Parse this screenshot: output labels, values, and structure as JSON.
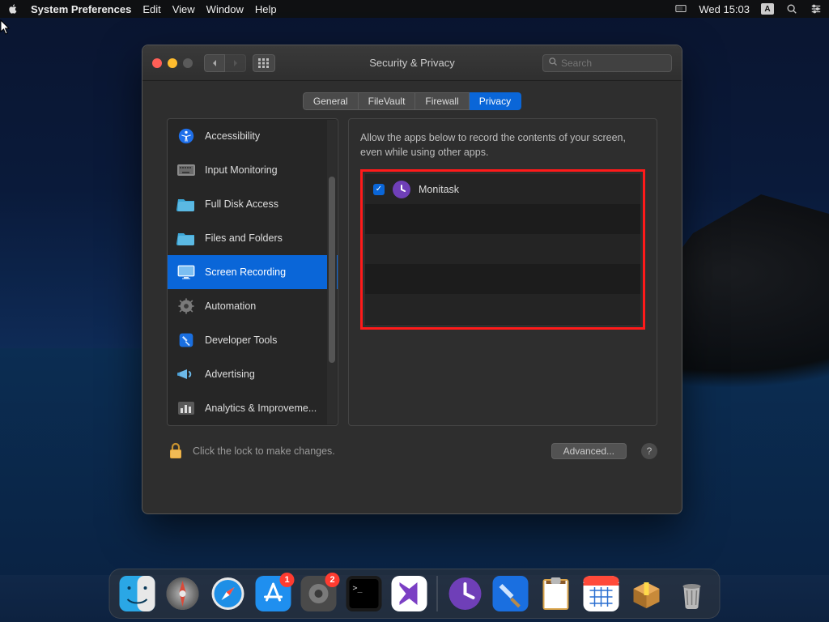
{
  "menubar": {
    "app_name": "System Preferences",
    "items": [
      "Edit",
      "View",
      "Window",
      "Help"
    ],
    "clock": "Wed 15:03",
    "input_indicator": "A"
  },
  "window": {
    "title": "Security & Privacy",
    "search_placeholder": "Search",
    "tabs": [
      "General",
      "FileVault",
      "Firewall",
      "Privacy"
    ],
    "active_tab": "Privacy"
  },
  "sidebar": {
    "items": [
      {
        "label": "Accessibility"
      },
      {
        "label": "Input Monitoring"
      },
      {
        "label": "Full Disk Access"
      },
      {
        "label": "Files and Folders"
      },
      {
        "label": "Screen Recording"
      },
      {
        "label": "Automation"
      },
      {
        "label": "Developer Tools"
      },
      {
        "label": "Advertising"
      },
      {
        "label": "Analytics & Improveme..."
      }
    ],
    "selected_index": 4
  },
  "content": {
    "description": "Allow the apps below to record the contents of your screen, even while using other apps.",
    "apps": [
      {
        "name": "Monitask",
        "checked": true
      }
    ]
  },
  "footer": {
    "lock_text": "Click the lock to make changes.",
    "advanced": "Advanced...",
    "help": "?"
  },
  "dock": {
    "items": [
      {
        "name": "finder"
      },
      {
        "name": "launchpad"
      },
      {
        "name": "safari"
      },
      {
        "name": "appstore",
        "badge": "1"
      },
      {
        "name": "settings",
        "badge": "2"
      },
      {
        "name": "terminal"
      },
      {
        "name": "visualstudio"
      }
    ],
    "items_right": [
      {
        "name": "monitask"
      },
      {
        "name": "xcode"
      },
      {
        "name": "notes"
      },
      {
        "name": "calendar"
      },
      {
        "name": "package"
      },
      {
        "name": "trash"
      }
    ]
  }
}
